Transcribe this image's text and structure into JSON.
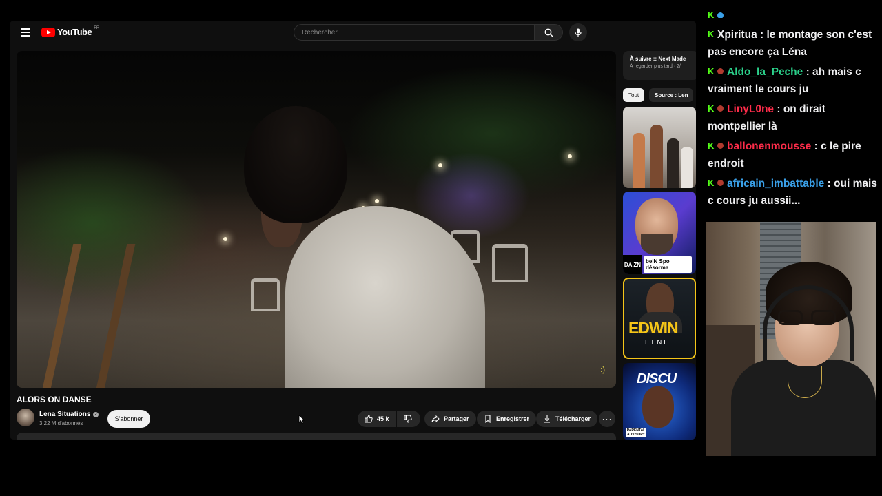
{
  "youtube": {
    "logo_text": "YouTube",
    "logo_region": "FR",
    "search_placeholder": "Rechercher"
  },
  "video": {
    "title": "ALORS ON DANSE",
    "watermark": ":)",
    "channel_name": "Lena Situations",
    "subscribers": "3,22 M d'abonnés",
    "subscribe_label": "S'abonner",
    "likes": "45 k",
    "share_label": "Partager",
    "save_label": "Enregistrer",
    "download_label": "Télécharger"
  },
  "sidebar": {
    "up_next_title": "À suivre :: Next Made",
    "up_next_sub": "À regarder plus tard · 2/",
    "chips": [
      "Tout",
      "Source : Len"
    ],
    "thumb2_logo": "DA ZN",
    "thumb2_caption": "beIN Spo désorma",
    "thumb3_big": "EDWIN",
    "thumb3_small": "L'ENT",
    "thumb4_text": "DISCU",
    "thumb4_label": "PARENTAL ADVISORY"
  },
  "chat": [
    {
      "user": "Xpiritua",
      "color": "#efeff1",
      "text": " : le montage son c'est pas encore ça Léna",
      "badges": [
        "k"
      ]
    },
    {
      "user": "Aldo_la_Peche",
      "color": "#2bd18b",
      "text": " : ah mais c vraiment le cours ju",
      "badges": [
        "k",
        "dot"
      ]
    },
    {
      "user": "LinyL0ne",
      "color": "#ff2c4a",
      "text": " : on dirait montpellier là",
      "badges": [
        "k",
        "dot"
      ]
    },
    {
      "user": "ballonenmousse",
      "color": "#ff2c4a",
      "text": " : c le pire endroit",
      "badges": [
        "k",
        "dot"
      ]
    },
    {
      "user": "africain_imbattable",
      "color": "#3aa0e8",
      "text": " : oui mais c cours ju aussii...",
      "badges": [
        "k",
        "dot"
      ]
    }
  ],
  "colors": {
    "youtube_red": "#ff0000",
    "twitch_green": "#53fc18"
  }
}
